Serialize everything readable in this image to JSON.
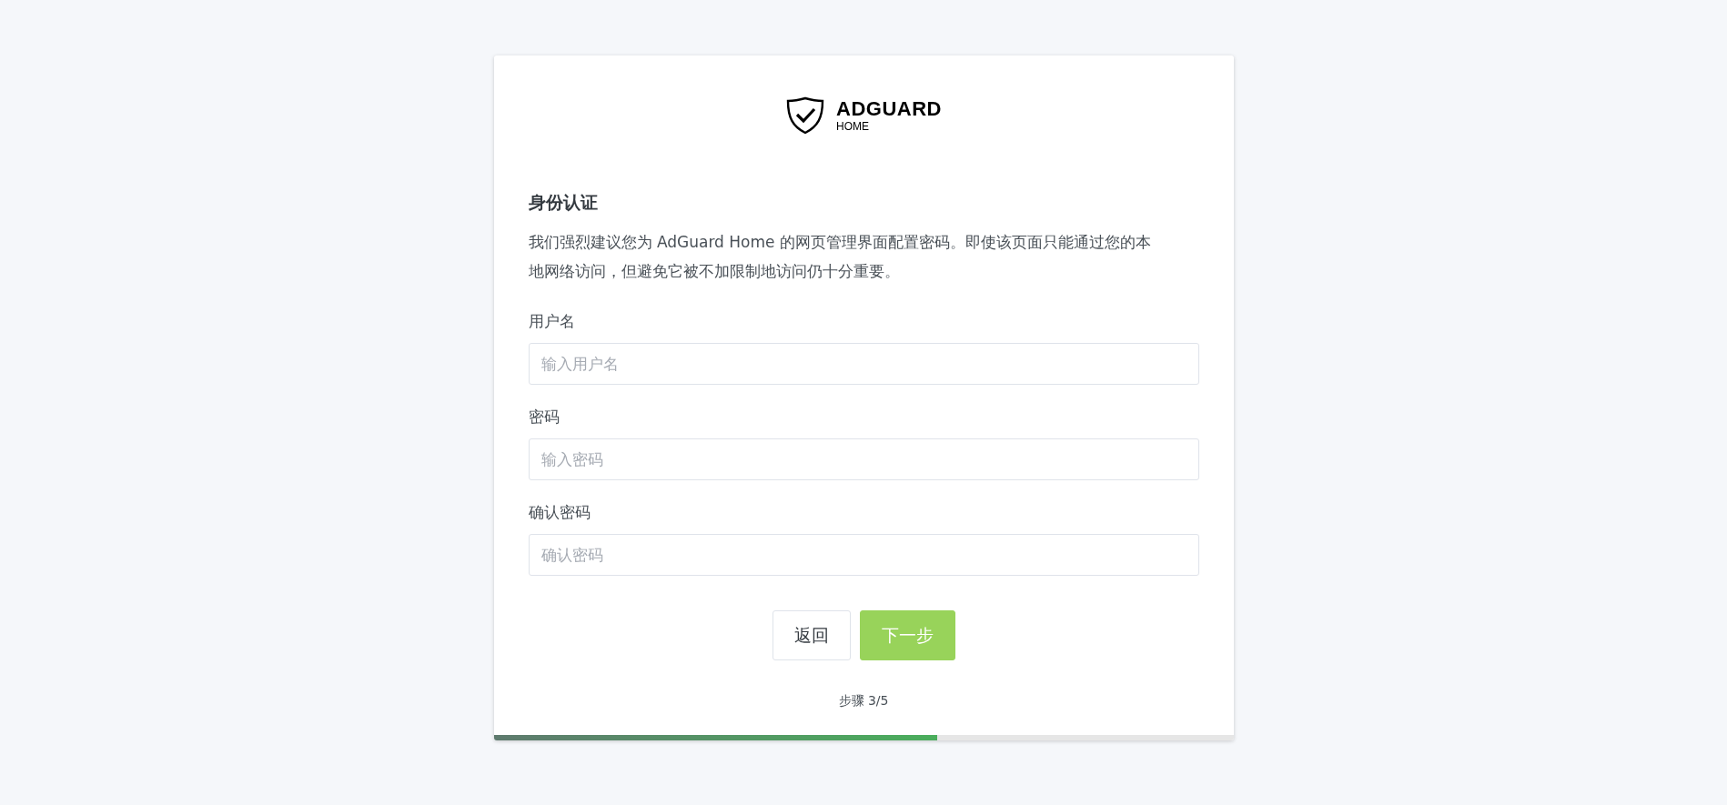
{
  "logo": {
    "name": "ADGUARD",
    "subtitle": "HOME"
  },
  "section": {
    "title": "身份认证",
    "description": "我们强烈建议您为 AdGuard Home 的网页管理界面配置密码。即使该页面只能通过您的本地网络访问，但避免它被不加限制地访问仍十分重要。"
  },
  "fields": [
    {
      "label": "用户名",
      "placeholder": "输入用户名"
    },
    {
      "label": "密码",
      "placeholder": "输入密码"
    },
    {
      "label": "确认密码",
      "placeholder": "确认密码"
    }
  ],
  "buttons": [
    {
      "label": "返回",
      "kind": "secondary"
    },
    {
      "label": "下一步",
      "kind": "primary"
    }
  ],
  "step": "步骤 3/5",
  "progress": {
    "level": 0.6
  }
}
